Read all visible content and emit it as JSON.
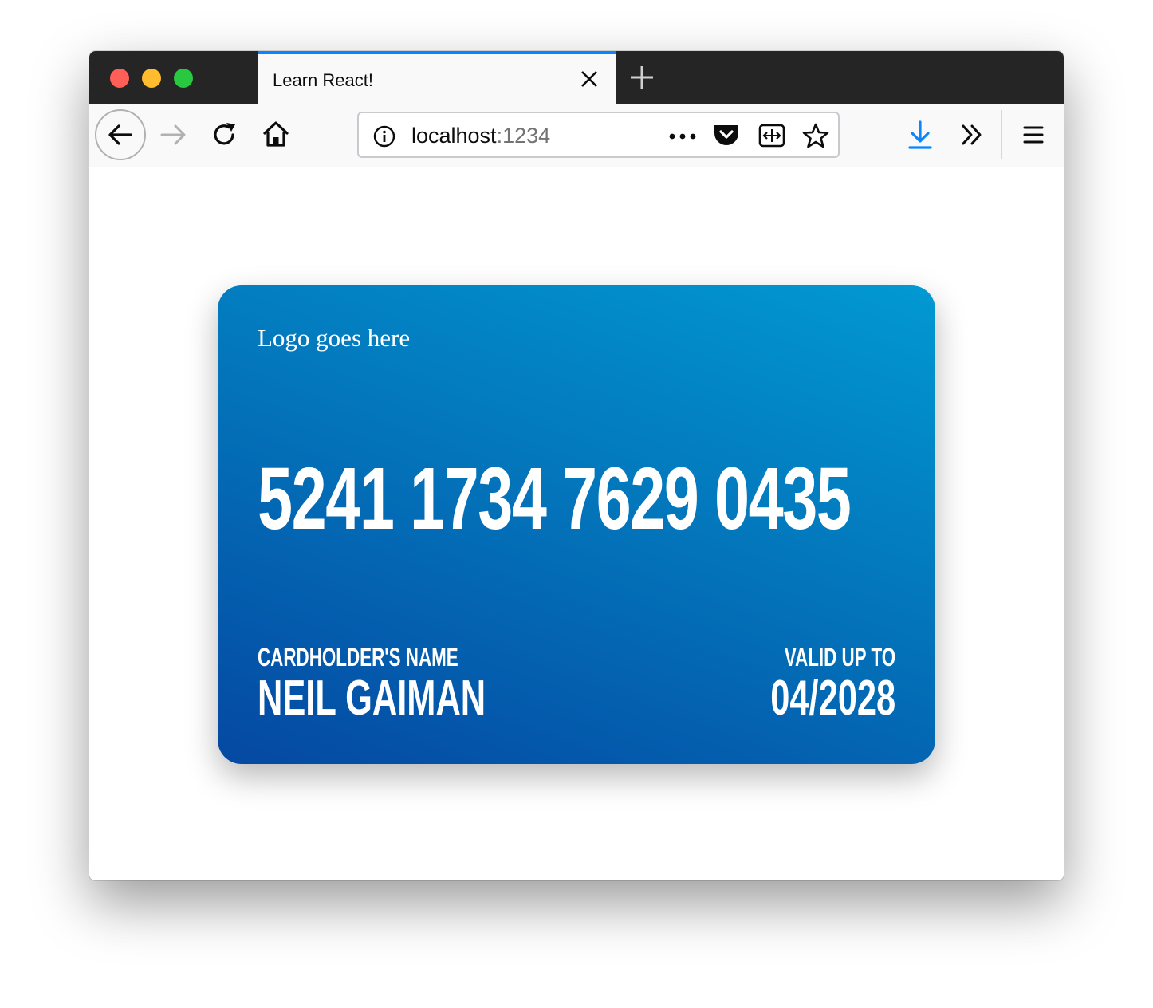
{
  "window": {
    "traffic_lights": [
      "close",
      "minimize",
      "zoom"
    ]
  },
  "tab": {
    "title": "Learn React!",
    "accent_color": "#0a84ff"
  },
  "toolbar": {
    "url_host": "localhost",
    "url_port": ":1234",
    "icons": [
      "back-icon",
      "forward-icon",
      "reload-icon",
      "home-icon",
      "info-icon",
      "page-actions-icon",
      "pocket-icon",
      "reader-view-icon",
      "bookmark-star-icon",
      "download-icon",
      "overflow-icon",
      "menu-icon"
    ]
  },
  "card": {
    "logo": "Logo goes here",
    "number": "5241 1734 7629 0435",
    "holder_label": "CARDHOLDER'S NAME",
    "holder_name": "NEIL GAIMAN",
    "valid_label": "VALID UP TO",
    "valid_date": "04/2028",
    "gradient_colors": [
      "#0548a2",
      "#0370b8",
      "#0299d2"
    ]
  }
}
